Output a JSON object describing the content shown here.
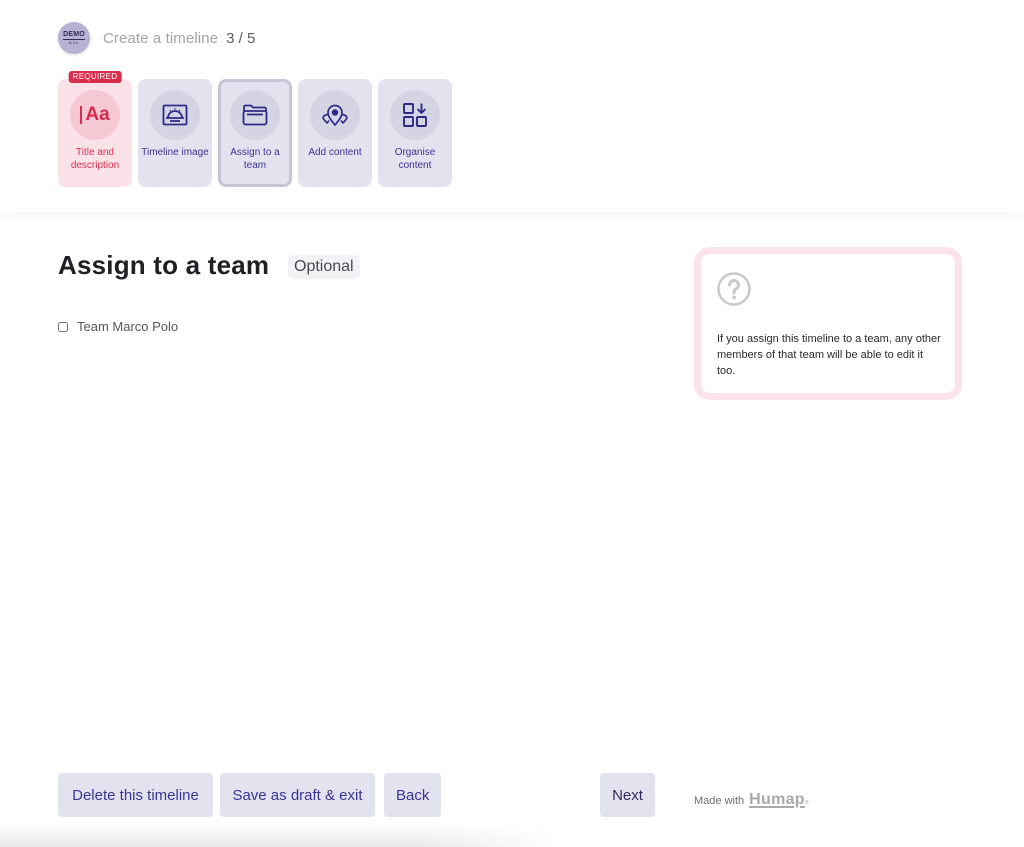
{
  "header": {
    "org_logo": {
      "line1": "DEMO",
      "line2": "& Co."
    },
    "wizard_title": "Create a timeline",
    "wizard_step": "3 / 5",
    "steps": [
      {
        "label": "Title and description",
        "icon": "text-aa-icon",
        "badge": "REQUIRED",
        "state": "required"
      },
      {
        "label": "Timeline image",
        "icon": "image-sunrise-icon",
        "state": "default"
      },
      {
        "label": "Assign to a team",
        "icon": "folder-icon",
        "state": "active"
      },
      {
        "label": "Add content",
        "icon": "map-pins-icon",
        "state": "default"
      },
      {
        "label": "Organise content",
        "icon": "grid-arrow-down-icon",
        "state": "default"
      }
    ]
  },
  "main": {
    "title": "Assign to a team",
    "optional_badge": "Optional",
    "teams": [
      {
        "label": "Team Marco Polo",
        "checked": false
      }
    ]
  },
  "help": {
    "icon": "question-circle-icon",
    "text": "If you assign this timeline to a team, any other members of that team will be able to edit it too."
  },
  "footer": {
    "delete_label": "Delete this timeline",
    "draft_label": "Save as draft & exit",
    "back_label": "Back",
    "next_label": "Next",
    "made_with": "Made with",
    "brand": "Humap",
    "brand_mark": "®"
  },
  "colors": {
    "accent": "#3b3590",
    "required": "#d92e4e",
    "step_bg": "#e3e2ef",
    "required_bg": "#fbe2e8",
    "help_border": "#fbe3e9"
  }
}
